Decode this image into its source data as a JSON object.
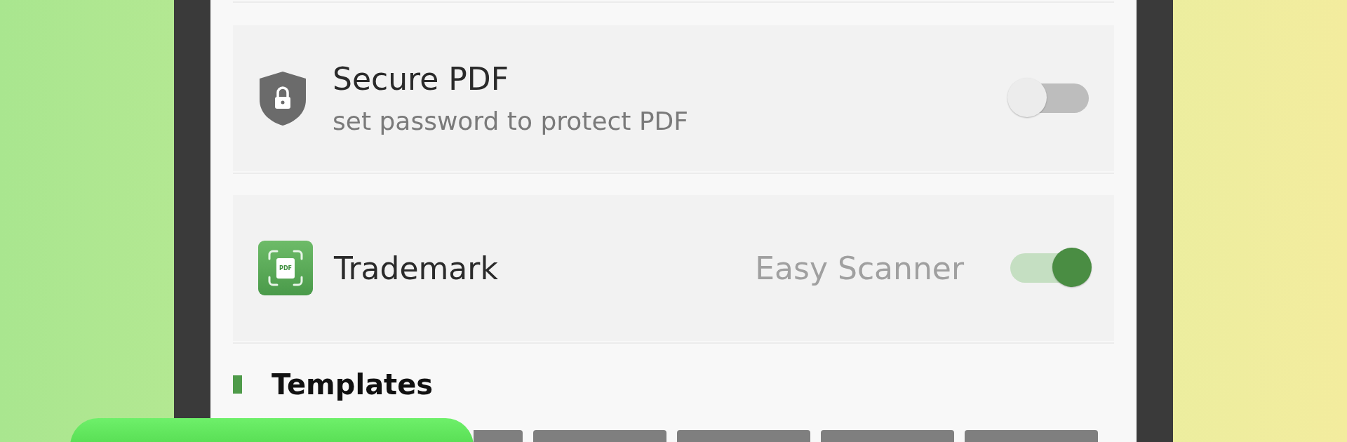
{
  "settings": [
    {
      "kind": "switch",
      "title": "Secure PDF",
      "subtitle": "set password to protect PDF",
      "on": false
    },
    {
      "kind": "switch",
      "icon_label": "PDF",
      "title": "Trademark",
      "value": "Easy Scanner",
      "on": true
    }
  ],
  "section": {
    "title": "Templates"
  },
  "templates": [
    {
      "kind": "thumbnail"
    },
    {
      "kind": "thumbnail"
    },
    {
      "kind": "thumbnail"
    },
    {
      "kind": "thumbnail"
    },
    {
      "kind": "thumbnail"
    }
  ]
}
